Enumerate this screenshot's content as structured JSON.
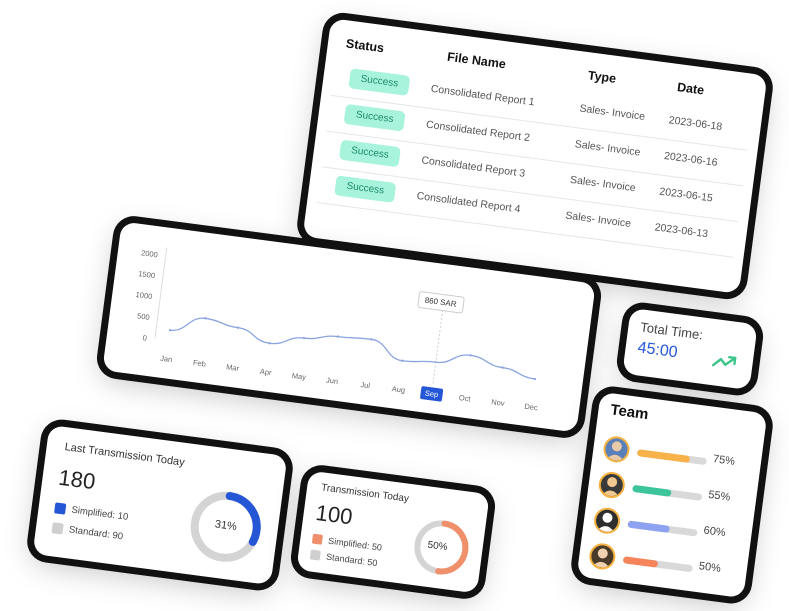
{
  "table": {
    "headers": {
      "status": "Status",
      "file": "File Name",
      "type": "Type",
      "date": "Date"
    },
    "rows": [
      {
        "status": "Success",
        "file": "Consolidated Report 1",
        "type": "Sales- Invoice",
        "date": "2023-06-18"
      },
      {
        "status": "Success",
        "file": "Consolidated Report 2",
        "type": "Sales- Invoice",
        "date": "2023-06-16"
      },
      {
        "status": "Success",
        "file": "Consolidated Report 3",
        "type": "Sales- Invoice",
        "date": "2023-06-15"
      },
      {
        "status": "Success",
        "file": "Consolidated Report 4",
        "type": "Sales- Invoice",
        "date": "2023-06-13"
      }
    ]
  },
  "chart_data": {
    "type": "line",
    "categories": [
      "Jan",
      "Feb",
      "Mar",
      "Apr",
      "May",
      "Jun",
      "Jul",
      "Aug",
      "Sep",
      "Oct",
      "Nov",
      "Dec"
    ],
    "values": [
      250,
      640,
      520,
      250,
      480,
      620,
      660,
      250,
      320,
      590,
      400,
      230
    ],
    "yticks": [
      "2000",
      "1500",
      "1000",
      "500",
      "0"
    ],
    "ylim": [
      0,
      2000
    ],
    "selected_category": "Sep",
    "tooltip": "860 SAR",
    "color": "#8aa4e0"
  },
  "last_transmission": {
    "title": "Last Transmission Today",
    "total": "180",
    "simplified": "Simplified: 10",
    "standard": "Standard: 90",
    "percent_label": "31%",
    "percent": 31,
    "color": "#2456d6"
  },
  "transmission_today": {
    "title": "Transmission Today",
    "total": "100",
    "simplified": "Simplified: 50",
    "standard": "Standard: 50",
    "percent_label": "50%",
    "percent": 50,
    "color": "#f0906a"
  },
  "total_time": {
    "label": "Total Time:",
    "value": "45:00",
    "trend_icon": "trending-up-icon",
    "trend_color": "#3cc48a"
  },
  "team": {
    "title": "Team",
    "members": [
      {
        "percent": 75,
        "label": "75%",
        "color": "#f7b24a"
      },
      {
        "percent": 55,
        "label": "55%",
        "color": "#3cc49a"
      },
      {
        "percent": 60,
        "label": "60%",
        "color": "#8ea2f2"
      },
      {
        "percent": 50,
        "label": "50%",
        "color": "#f5845a"
      }
    ]
  }
}
